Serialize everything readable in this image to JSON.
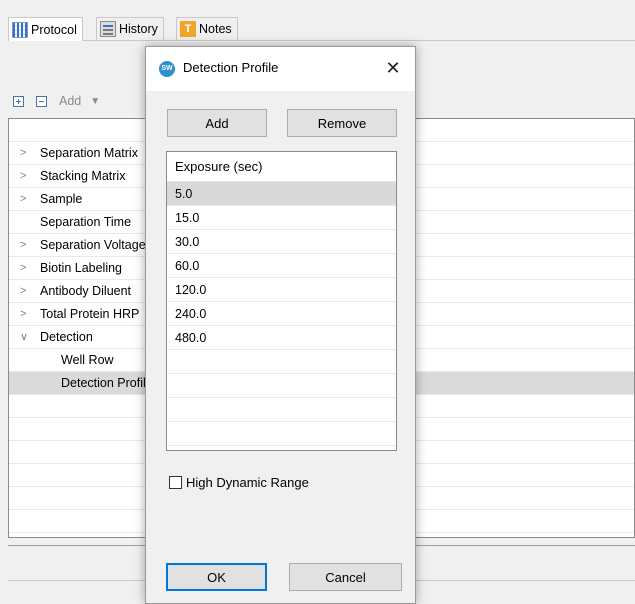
{
  "tabs": [
    {
      "label": "Protocol",
      "icon": "protocol-icon",
      "active": true
    },
    {
      "label": "History",
      "icon": "history-icon",
      "active": false
    },
    {
      "label": "Notes",
      "icon": "notes-icon",
      "active": false
    }
  ],
  "toolbar": {
    "add_label": "Add"
  },
  "tree": {
    "rows": [
      {
        "label": "",
        "expand": ""
      },
      {
        "label": "Separation Matrix",
        "expand": ">"
      },
      {
        "label": "Stacking Matrix",
        "expand": ">"
      },
      {
        "label": "Sample",
        "expand": ">"
      },
      {
        "label": "Separation Time",
        "expand": ""
      },
      {
        "label": "Separation Voltage",
        "expand": ">"
      },
      {
        "label": "Biotin Labeling",
        "expand": ">"
      },
      {
        "label": "Antibody Diluent",
        "expand": ">"
      },
      {
        "label": "Total Protein HRP",
        "expand": ">"
      },
      {
        "label": "Detection",
        "expand": "v"
      },
      {
        "label": "Well Row",
        "expand": ""
      },
      {
        "label": "Detection Profile",
        "expand": ""
      }
    ]
  },
  "dialog": {
    "title": "Detection Profile",
    "close_symbol": "✕",
    "add_label": "Add",
    "remove_label": "Remove",
    "column_header": "Exposure (sec)",
    "exposures": [
      "5.0",
      "15.0",
      "30.0",
      "60.0",
      "120.0",
      "240.0",
      "480.0"
    ],
    "selected_index": 0,
    "high_dynamic_range_label": "High Dynamic Range",
    "high_dynamic_range_checked": false,
    "ok_label": "OK",
    "cancel_label": "Cancel"
  },
  "colors": {
    "accent": "#0078d7",
    "selection": "#d9d9d9",
    "logo": "#2e8fd0"
  }
}
